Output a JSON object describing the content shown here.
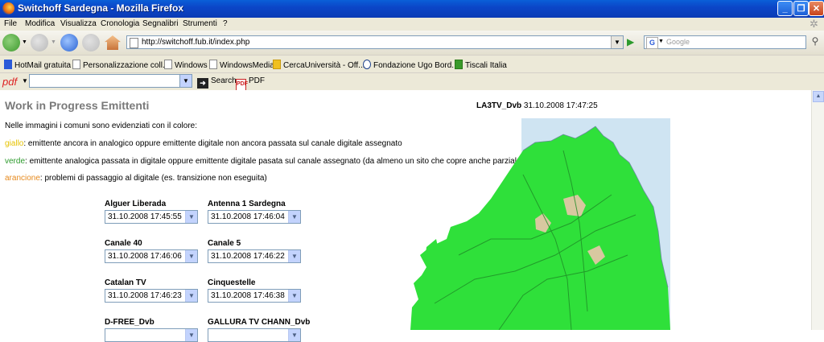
{
  "window": {
    "title": "Switchoff Sardegna - Mozilla Firefox",
    "buttons": [
      "_",
      "❐",
      "✕"
    ]
  },
  "menu": [
    "File",
    "Modifica",
    "Visualizza",
    "Cronologia",
    "Segnalibri",
    "Strumenti",
    "?"
  ],
  "nav": {
    "url": "http://switchoff.fub.it/index.php",
    "search_placeholder": "Google",
    "search_engine": "G"
  },
  "bookmarks": [
    "HotMail gratuita",
    "Personalizzazione coll...",
    "Windows",
    "WindowsMedia",
    "CercaUniversità - Off...",
    "Fondazione Ugo Bord...",
    "Tiscali Italia"
  ],
  "pdf_toolbar": {
    "logo": "pdf",
    "search_label": "Search",
    "pdf_label": "PDF"
  },
  "page": {
    "title": "Work in Progress Emittenti",
    "intro": "Nelle immagini i comuni sono evidenziati con il colore:",
    "legend": {
      "yellow_word": "giallo",
      "yellow_text": ": emittente ancora in analogico oppure emittente digitale non ancora passata sul canale digitale assegnato",
      "green_word": "verde",
      "green_text": ": emittente analogica passata in digitale oppure emittente digitale pasata sul canale assegnato (da almeno un sito che copre anche parzialmente il comune)",
      "orange_word": "arancione",
      "orange_text": ": problemi di passaggio al digitale (es. transizione non eseguita)"
    },
    "emitters": [
      {
        "name": "Alguer Liberada",
        "value": "31.10.2008 17:45:55"
      },
      {
        "name": "Antenna 1 Sardegna",
        "value": "31.10.2008 17:46:04"
      },
      {
        "name": "Canale 40",
        "value": "31.10.2008 17:46:06"
      },
      {
        "name": "Canale 5",
        "value": "31.10.2008 17:46:22"
      },
      {
        "name": "Catalan TV",
        "value": "31.10.2008 17:46:23"
      },
      {
        "name": "Cinquestelle",
        "value": "31.10.2008 17:46:38"
      },
      {
        "name": "D-FREE_Dvb",
        "value": ""
      },
      {
        "name": "GALLURA TV CHANN_Dvb",
        "value": ""
      }
    ],
    "map_caption": {
      "name": "LA3TV_Dvb",
      "timestamp": "31.10.2008 17:47:25"
    }
  },
  "colors": {
    "yellow": "#e6c200",
    "green": "#2c9a2c",
    "orange": "#e68a1e",
    "map_green": "#2fe03a",
    "sea": "#cfe4f2"
  }
}
